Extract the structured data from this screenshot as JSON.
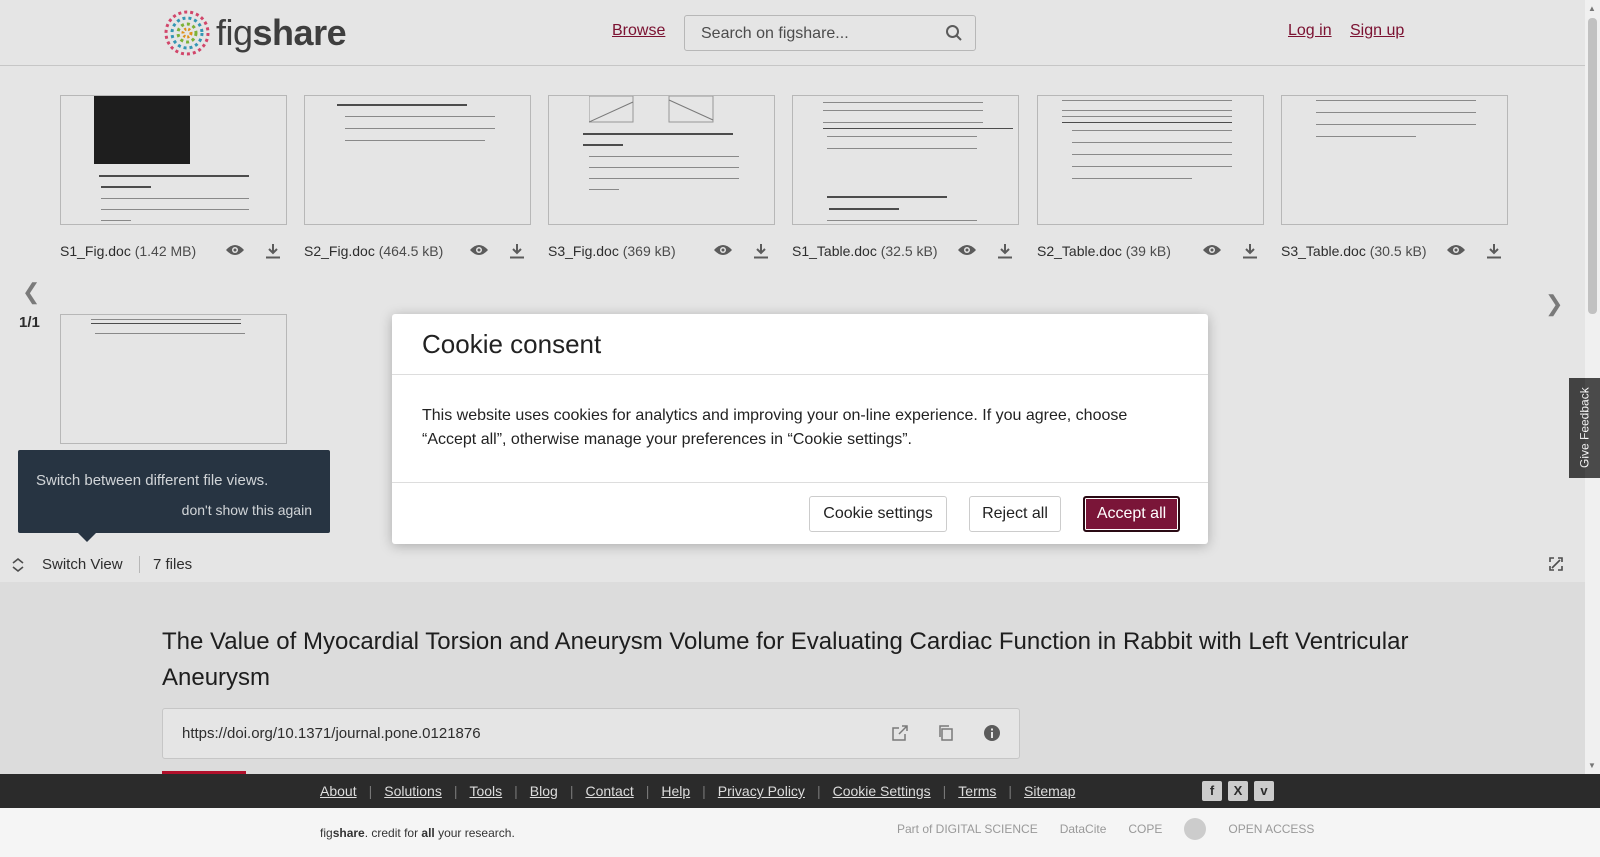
{
  "header": {
    "logo_text": "figshare",
    "browse_label": "Browse",
    "search_placeholder": "Search on figshare...",
    "login_label": "Log in",
    "signup_label": "Sign up"
  },
  "files": [
    {
      "name": "S1_Fig.doc",
      "size": "(1.42 MB)"
    },
    {
      "name": "S2_Fig.doc",
      "size": "(464.5 kB)"
    },
    {
      "name": "S3_Fig.doc",
      "size": "(369 kB)"
    },
    {
      "name": "S1_Table.doc",
      "size": "(32.5 kB)"
    },
    {
      "name": "S2_Table.doc",
      "size": "(39 kB)"
    },
    {
      "name": "S3_Table.doc",
      "size": "(30.5 kB)"
    }
  ],
  "pager": "1/1",
  "tooltip": {
    "message": "Switch between different file views.",
    "dismiss": "don't show this again"
  },
  "switch_bar": {
    "switch_label": "Switch View",
    "file_count": "7 files"
  },
  "article": {
    "title": "The Value of Myocardial Torsion and Aneurysm Volume for Evaluating Cardiac Function in Rabbit with Left Ventricular Aneurysm",
    "doi": "https://doi.org/10.1371/journal.pone.0121876"
  },
  "cookie_modal": {
    "title": "Cookie consent",
    "body": "This website uses cookies for analytics and improving your on-line experience. If you agree, choose “Accept all”, otherwise manage your preferences in “Cookie settings”.",
    "settings_label": "Cookie settings",
    "reject_label": "Reject all",
    "accept_label": "Accept all"
  },
  "feedback_label": "Give Feedback",
  "footer": {
    "links": [
      "About",
      "Solutions",
      "Tools",
      "Blog",
      "Contact",
      "Help",
      "Privacy Policy",
      "Cookie Settings",
      "Terms",
      "Sitemap"
    ],
    "credit_fig": "fig",
    "credit_share": "share",
    "credit_mid": ". credit for ",
    "credit_all": "all",
    "credit_end": " your research.",
    "partners": [
      "Part of DIGITAL SCIENCE",
      "DataCite",
      "COPE",
      "",
      "OPEN ACCESS"
    ]
  },
  "colors": {
    "brand": "#8a1538",
    "accept": "#7a1538",
    "footer_bar": "#2b2b2b",
    "tooltip": "#2c3a4a"
  }
}
